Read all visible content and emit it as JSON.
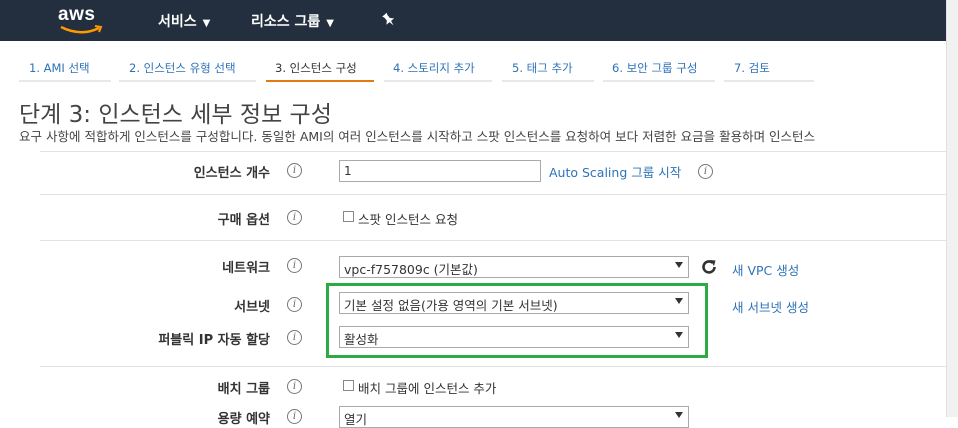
{
  "nav": {
    "logo": "aws",
    "services_label": "서비스",
    "resource_groups_label": "리소스 그룹",
    "pin_icon": "pin-icon"
  },
  "steps": [
    {
      "label": "1. AMI 선택",
      "active": false
    },
    {
      "label": "2. 인스턴스 유형 선택",
      "active": false
    },
    {
      "label": "3. 인스턴스 구성",
      "active": true
    },
    {
      "label": "4. 스토리지 추가",
      "active": false
    },
    {
      "label": "5. 태그 추가",
      "active": false
    },
    {
      "label": "6. 보안 그룹 구성",
      "active": false
    },
    {
      "label": "7. 검토",
      "active": false
    }
  ],
  "page": {
    "title": "단계 3: 인스턴스 세부 정보 구성",
    "description": "요구 사항에 적합하게 인스턴스를 구성합니다. 동일한 AMI의 여러 인스턴스를 시작하고 스팟 인스턴스를 요청하여 보다 저렴한 요금을 활용하며 인스턴스"
  },
  "form": {
    "instance_count": {
      "label": "인스턴스 개수",
      "value": "1",
      "link": "Auto Scaling 그룹 시작"
    },
    "purchase_option": {
      "label": "구매 옵션",
      "checkbox_label": "스팟 인스턴스 요청"
    },
    "network": {
      "label": "네트워크",
      "selected": "vpc-f757809c (기본값)",
      "link": "새 VPC 생성"
    },
    "subnet": {
      "label": "서브넷",
      "selected": "기본 설정 없음(가용 영역의 기본 서브넷)",
      "link": "새 서브넷 생성"
    },
    "public_ip": {
      "label": "퍼블릭 IP 자동 할당",
      "selected": "활성화"
    },
    "placement_group": {
      "label": "배치 그룹",
      "checkbox_label": "배치 그룹에 인스턴스 추가"
    },
    "capacity_reservation": {
      "label": "용량 예약",
      "selected": "열기"
    }
  },
  "colors": {
    "nav_bg": "#232f3e",
    "link": "#2e73b8",
    "active_step": "#e47911",
    "highlight": "#2eaa44"
  }
}
